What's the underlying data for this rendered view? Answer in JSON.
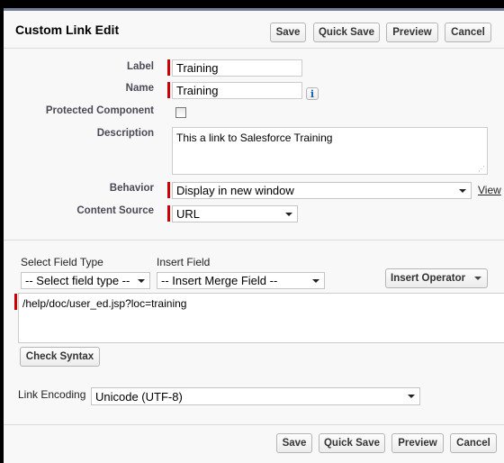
{
  "header": {
    "title": "Custom Link Edit"
  },
  "toolbar": {
    "save": "Save",
    "quick_save": "Quick Save",
    "preview": "Preview",
    "cancel": "Cancel"
  },
  "form": {
    "label": {
      "label": "Label",
      "value": "Training"
    },
    "name": {
      "label": "Name",
      "value": "Training",
      "info_icon": "i"
    },
    "protected": {
      "label": "Protected Component",
      "checked": false
    },
    "description": {
      "label": "Description",
      "value": "This a link to Salesforce Training"
    },
    "behavior": {
      "label": "Behavior",
      "value": "Display in new window",
      "link": "View"
    },
    "content_source": {
      "label": "Content Source",
      "value": "URL"
    }
  },
  "formula": {
    "select_field_type_label": "Select Field Type",
    "select_field_type_value": "-- Select field type --",
    "insert_field_label": "Insert Field",
    "insert_field_value": "-- Insert Merge Field --",
    "insert_operator": "Insert Operator",
    "url_value": "/help/doc/user_ed.jsp?loc=training",
    "check_syntax": "Check Syntax"
  },
  "encoding": {
    "label": "Link Encoding",
    "value": "Unicode (UTF-8)"
  },
  "colors": {
    "required": "#cc0000",
    "header_bar": "#747e96"
  }
}
